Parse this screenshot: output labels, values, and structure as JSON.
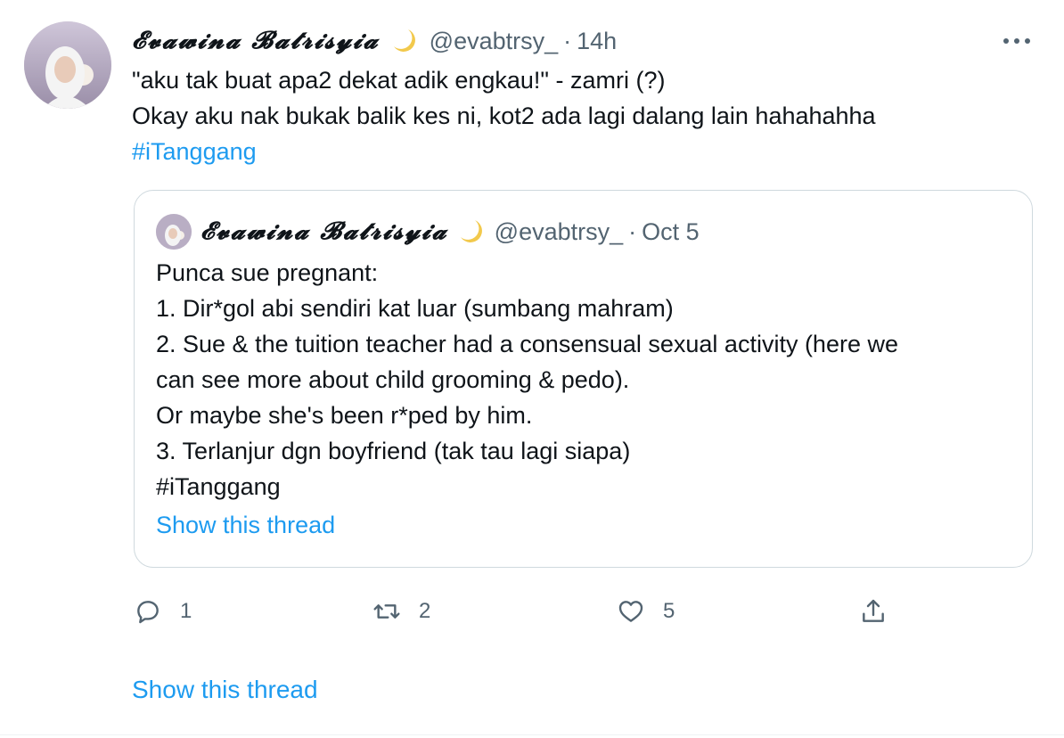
{
  "tweet": {
    "display_name": "𝓔𝓿𝓪𝔀𝓲𝓷𝓪 𝓑𝓪𝓽𝓻𝓲𝓼𝔂𝓲𝓪",
    "handle": "@evabtrsy_",
    "separator": "·",
    "time": "14h",
    "lines": [
      "\"aku tak buat apa2 dekat adik engkau!\" - zamri (?)",
      "Okay aku nak bukak balik kes ni, kot2 ada lagi dalang lain hahahahha"
    ],
    "hashtag": "#iTanggang",
    "actions": {
      "reply_count": "1",
      "retweet_count": "2",
      "like_count": "5"
    },
    "show_thread": "Show this thread"
  },
  "quote": {
    "display_name": "𝓔𝓿𝓪𝔀𝓲𝓷𝓪 𝓑𝓪𝓽𝓻𝓲𝓼𝔂𝓲𝓪",
    "handle": "@evabtrsy_",
    "separator": "·",
    "date": "Oct 5",
    "lines": [
      "Punca sue pregnant:",
      "1. Dir*gol abi sendiri kat luar (sumbang mahram)",
      "2. Sue & the tuition teacher had a consensual sexual activity (here we",
      "can see more about child grooming & pedo).",
      "Or maybe she's been r*ped by him.",
      "3. Terlanjur dgn boyfriend (tak tau lagi siapa)",
      "#iTanggang"
    ],
    "show_thread": "Show this thread"
  },
  "icons": {
    "moon": "crescent-moon-icon",
    "more": "more-icon",
    "reply": "reply-icon",
    "retweet": "retweet-icon",
    "like": "heart-icon",
    "share": "share-icon"
  },
  "colors": {
    "link": "#1d9bf0",
    "secondary": "#536471",
    "border": "#cfd9de"
  }
}
